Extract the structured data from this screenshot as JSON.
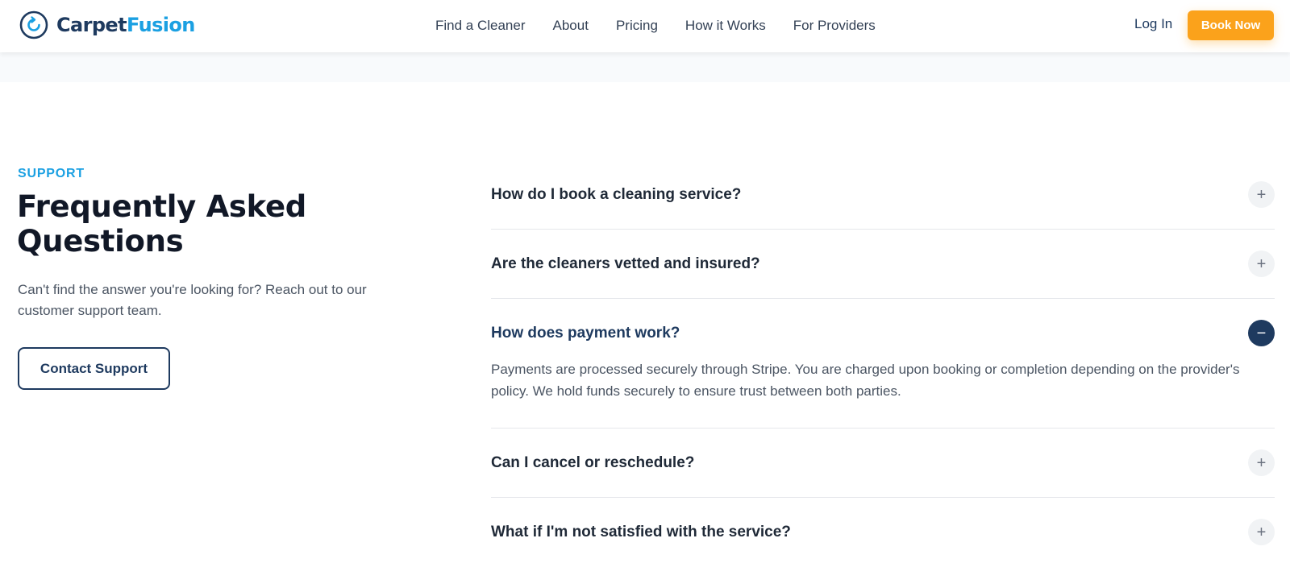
{
  "brand": {
    "name_part1": "Carpet",
    "name_part2": "Fusion"
  },
  "nav": {
    "items": [
      {
        "label": "Find a Cleaner"
      },
      {
        "label": "About"
      },
      {
        "label": "Pricing"
      },
      {
        "label": "How it Works"
      },
      {
        "label": "For Providers"
      }
    ],
    "login_label": "Log In",
    "book_label": "Book Now"
  },
  "section": {
    "eyebrow": "SUPPORT",
    "title": "Frequently Asked Questions",
    "subtitle": "Can't find the answer you're looking for? Reach out to our customer support team.",
    "contact_label": "Contact Support"
  },
  "faq": [
    {
      "question": "How do I book a cleaning service?",
      "open": false,
      "icon": "plus-icon",
      "symbol": "+"
    },
    {
      "question": "Are the cleaners vetted and insured?",
      "open": false,
      "icon": "plus-icon",
      "symbol": "+"
    },
    {
      "question": "How does payment work?",
      "open": true,
      "icon": "minus-icon",
      "symbol": "−",
      "answer": "Payments are processed securely through Stripe. You are charged upon booking or completion depending on the provider's policy. We hold funds securely to ensure trust between both parties."
    },
    {
      "question": "Can I cancel or reschedule?",
      "open": false,
      "icon": "plus-icon",
      "symbol": "+"
    },
    {
      "question": "What if I'm not satisfied with the service?",
      "open": false,
      "icon": "plus-icon",
      "symbol": "+"
    }
  ],
  "colors": {
    "navy": "#1e3a5f",
    "sky": "#1ba0e2",
    "orange": "#fba21b"
  }
}
